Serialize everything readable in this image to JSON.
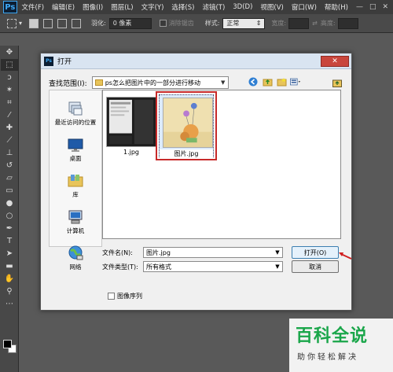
{
  "app": {
    "logo": "Ps"
  },
  "menu": {
    "items": [
      "文件(F)",
      "编辑(E)",
      "图像(I)",
      "图层(L)",
      "文字(Y)",
      "选择(S)",
      "滤镜(T)",
      "3D(D)",
      "视图(V)",
      "窗口(W)",
      "帮助(H)"
    ],
    "window_controls": [
      "—",
      "□",
      "✕"
    ]
  },
  "options_bar": {
    "feather_label": "羽化:",
    "feather_value": "0 像素",
    "antialias_label": "消除锯齿",
    "style_label": "样式:",
    "style_value": "正常",
    "width_label": "宽度:",
    "height_label": "高度:"
  },
  "tools": [
    "move-icon",
    "marquee-icon",
    "lasso-icon",
    "magic-wand-icon",
    "crop-icon",
    "eyedropper-icon",
    "healing-icon",
    "brush-icon",
    "stamp-icon",
    "history-brush-icon",
    "eraser-icon",
    "gradient-icon",
    "blur-icon",
    "dodge-icon",
    "pen-icon",
    "type-icon",
    "path-select-icon",
    "shape-icon",
    "hand-icon",
    "zoom-icon"
  ],
  "dialog": {
    "title": "打开",
    "close_label": "✕",
    "lookin_label": "查找范围(I):",
    "lookin_value": "ps怎么把图片中的一部分进行移动",
    "places": [
      {
        "icon": "recent-places-icon",
        "label": "最近访问的位置"
      },
      {
        "icon": "desktop-icon",
        "label": "桌面"
      },
      {
        "icon": "library-icon",
        "label": "库"
      },
      {
        "icon": "computer-icon",
        "label": "计算机"
      },
      {
        "icon": "network-icon",
        "label": "网络"
      }
    ],
    "files": [
      {
        "name": "1.jpg",
        "selected": false
      },
      {
        "name": "图片.jpg",
        "selected": true
      }
    ],
    "filename_label": "文件名(N):",
    "filename_value": "图片.jpg",
    "filetype_label": "文件类型(T):",
    "filetype_value": "所有格式",
    "open_button": "打开(O)",
    "cancel_button": "取消",
    "image_sequence_label": "图像序列"
  },
  "watermark": {
    "title": "百科全说",
    "subtitle": "助你轻松解决"
  },
  "colors": {
    "highlight": "#c72a2a",
    "watermark_green": "#1aa64a"
  }
}
